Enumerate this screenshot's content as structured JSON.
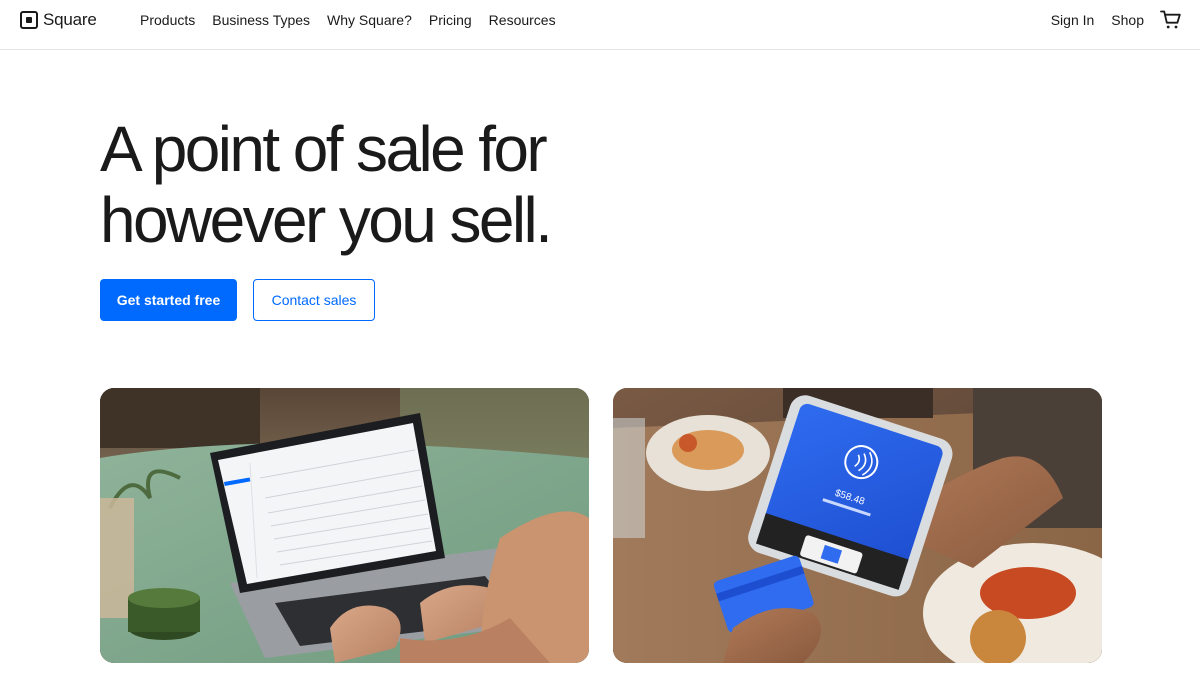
{
  "nav": {
    "logo_text": "Square",
    "links": [
      "Products",
      "Business Types",
      "Why Square?",
      "Pricing",
      "Resources"
    ],
    "sign_in": "Sign In",
    "shop": "Shop",
    "cart_icon": "shopping-cart-icon"
  },
  "hero": {
    "title_line1": "A point of sale for",
    "title_line2": "however you sell.",
    "primary_cta": "Get started free",
    "secondary_cta": "Contact sales"
  },
  "media": {
    "left_image": "laptop-dashboard-photo",
    "right_image": "card-payment-terminal-photo",
    "terminal_amount": "$58.48"
  },
  "colors": {
    "accent": "#006aff",
    "text": "#1a1a1a",
    "divider": "#e5e5e5"
  }
}
